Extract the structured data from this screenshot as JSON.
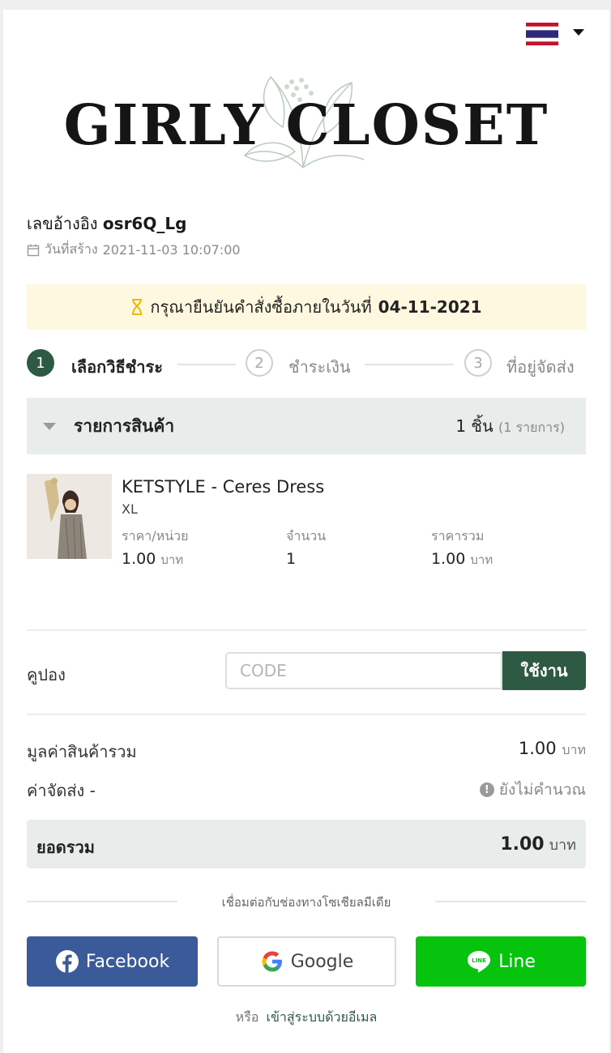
{
  "language": {
    "current": "Thai",
    "flag_icon": "thailand-flag-icon"
  },
  "brand": {
    "name": "GIRLY CLOSET"
  },
  "order": {
    "ref_label": "เลขอ้างอิง",
    "ref_value": "osr6Q_Lg",
    "created_label": "วันที่สร้าง",
    "created_value": "2021-11-03 10:07:00"
  },
  "notice": {
    "text": "กรุณายืนยันคำสั่งซื้อภายในวันที่",
    "date": "04-11-2021"
  },
  "steps": [
    {
      "num": "1",
      "label": "เลือกวิธีชำระ",
      "active": true
    },
    {
      "num": "2",
      "label": "ชำระเงิน",
      "active": false
    },
    {
      "num": "3",
      "label": "ที่อยู่จัดส่ง",
      "active": false
    }
  ],
  "items": {
    "title": "รายการสินค้า",
    "count": "1 ชิ้น",
    "count_detail": "(1 รายการ)",
    "list": [
      {
        "name": "KETSTYLE - Ceres Dress",
        "variant": "XL",
        "price_label": "ราคา/หน่วย",
        "price": "1.00",
        "qty_label": "จำนวน",
        "qty": "1",
        "total_label": "ราคารวม",
        "total": "1.00",
        "unit": "บาท"
      }
    ]
  },
  "coupon": {
    "label": "คูปอง",
    "placeholder": "CODE",
    "value": "",
    "button": "ใช้งาน"
  },
  "summary": {
    "subtotal_label": "มูลค่าสินค้ารวม",
    "subtotal_value": "1.00",
    "shipping_label": "ค่าจัดส่ง -",
    "shipping_value": "ยังไม่คำนวณ",
    "unit": "บาท",
    "total_label": "ยอดรวม",
    "total_value": "1.00"
  },
  "social": {
    "heading": "เชื่อมต่อกับช่องทางโซเชียลมีเดีย",
    "facebook": "Facebook",
    "google": "Google",
    "line": "Line",
    "or": "หรือ",
    "email_link": "เข้าสู่ระบบด้วยอีเมล"
  },
  "colors": {
    "accent": "#2e5a43",
    "facebook": "#3b5a9a",
    "line": "#06c30d",
    "notice_bg": "#fff8e1"
  }
}
